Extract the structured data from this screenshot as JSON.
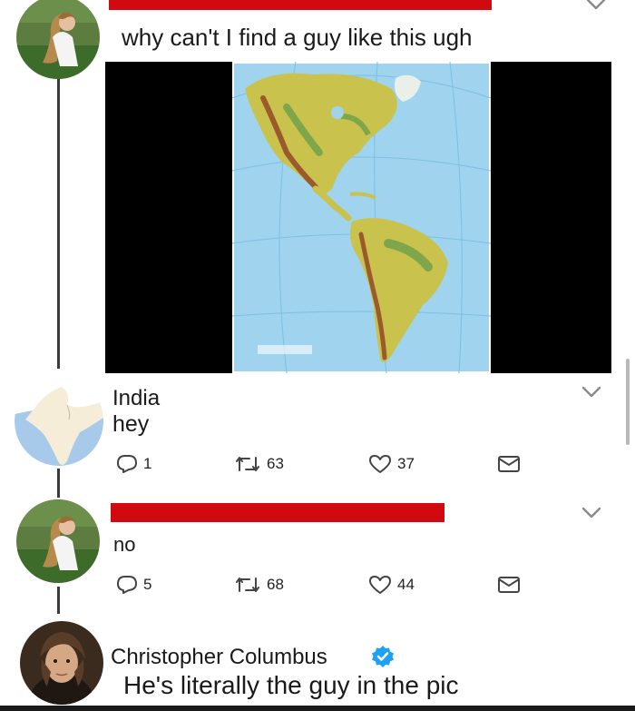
{
  "tweet1": {
    "text": "why can't I find a guy like this ugh",
    "avatar_icon": "woman-field-photo",
    "media_icon": "americas-map-image"
  },
  "tweet2": {
    "name": "India",
    "text": "hey",
    "avatar_icon": "india-map-avatar",
    "counts": {
      "reply": "1",
      "retweet": "63",
      "like": "37"
    }
  },
  "tweet3": {
    "text": "no",
    "avatar_icon": "woman-field-photo",
    "counts": {
      "reply": "5",
      "retweet": "68",
      "like": "44"
    }
  },
  "tweet4": {
    "name": "Christopher Columbus",
    "text": "He's literally the guy in the pic",
    "avatar_icon": "columbus-portrait",
    "verified": true
  },
  "colors": {
    "redaction": "#d10a10",
    "verified": "#1da1f2",
    "ocean": "#9fd3ee",
    "land": "#c9c24d"
  }
}
